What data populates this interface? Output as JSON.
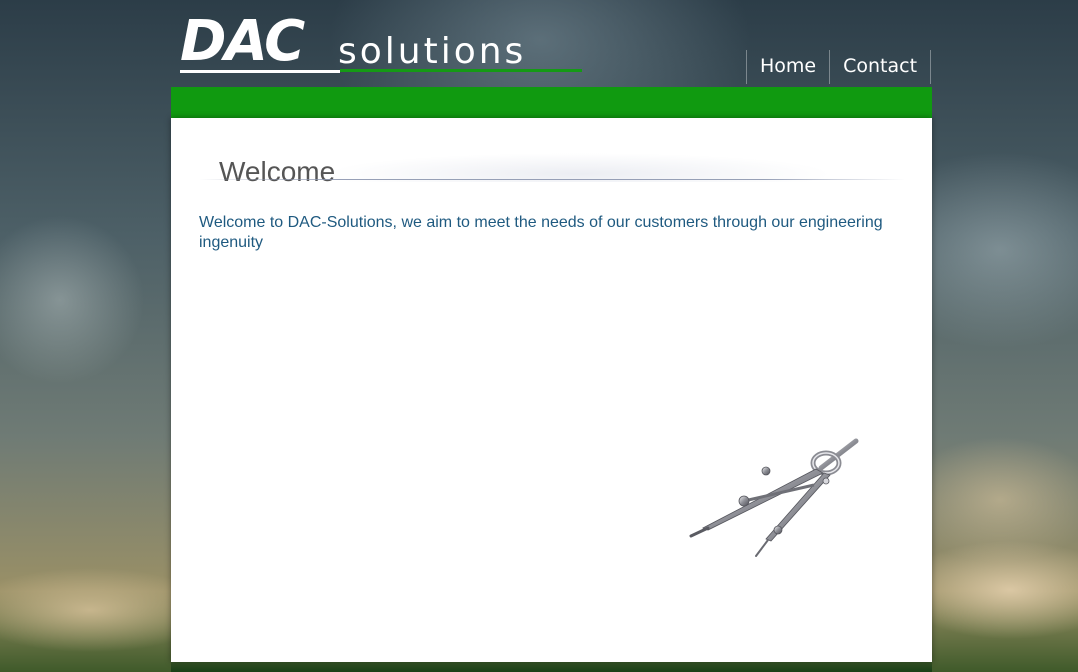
{
  "logo": {
    "primary": "DAC",
    "secondary": "solutions"
  },
  "nav": {
    "items": [
      {
        "label": "Home"
      },
      {
        "label": "Contact"
      }
    ]
  },
  "main": {
    "heading": "Welcome",
    "intro": "Welcome to DAC-Solutions, we aim to meet the needs of our customers through our engineering ingenuity"
  },
  "colors": {
    "brand_green": "#109a10",
    "intro_text": "#1f5a80",
    "heading_text": "#555555"
  },
  "icons": {
    "illustration": "drafting-compass-icon"
  }
}
